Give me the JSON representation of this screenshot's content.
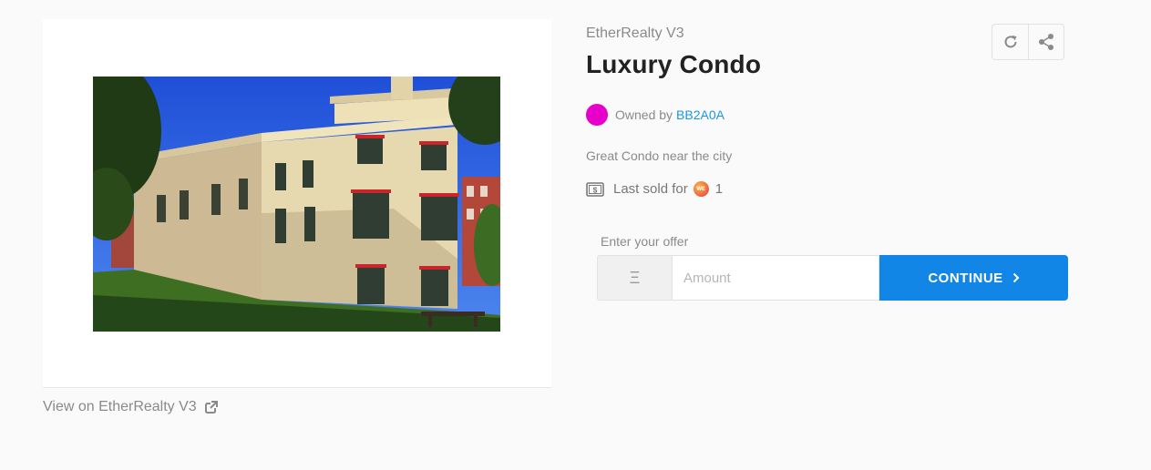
{
  "listing": {
    "collection": "EtherRealty V3",
    "title": "Luxury Condo",
    "owned_by_label": "Owned by",
    "owner": "BB2A0A",
    "owner_avatar_color": "#e600c9",
    "description": "Great Condo near the city",
    "last_sold_label": "Last sold for",
    "last_sold_token_glyph": "WE",
    "last_sold_value": "1"
  },
  "image": {
    "alt": "Luxury Condo"
  },
  "view_link": {
    "label": "View on EtherRealty V3",
    "icon": "external-link-icon"
  },
  "actions": {
    "refresh_icon": "refresh-icon",
    "share_icon": "share-icon"
  },
  "offer": {
    "label": "Enter your offer",
    "currency_symbol": "Ξ",
    "amount_placeholder": "Amount",
    "amount_value": "",
    "continue_label": "CONTINUE",
    "continue_icon": "chevron-right-icon"
  },
  "colors": {
    "accent": "#1186e6",
    "link": "#1a98e0",
    "muted_text": "#8a8a8a"
  }
}
